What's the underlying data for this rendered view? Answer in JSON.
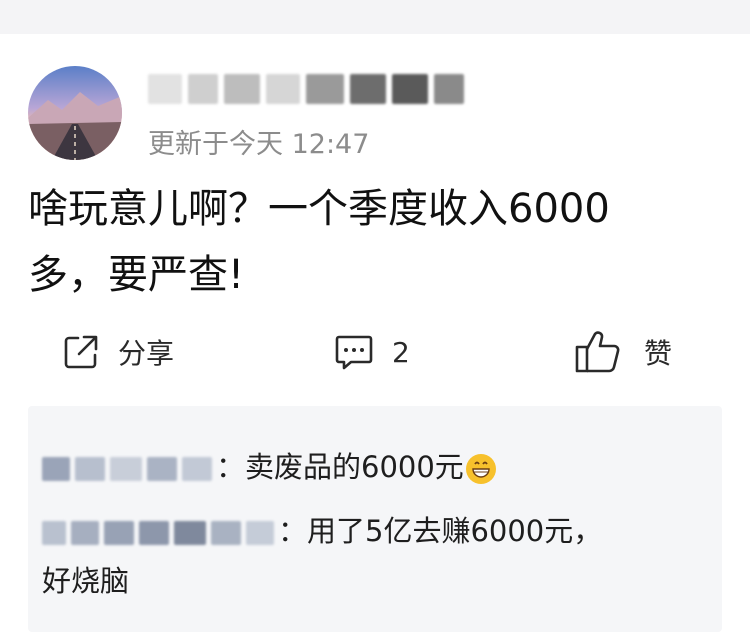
{
  "post": {
    "timestamp": "更新于今天 12:47",
    "text_line1": "啥玩意儿啊？一个季度收入6000",
    "text_line2": "多，要严查!"
  },
  "actions": {
    "share_label": "分享",
    "comment_count": "2",
    "like_label": "赞"
  },
  "comments": [
    {
      "text": "：卖废品的6000元"
    },
    {
      "text": "：用了5亿去赚6000元，",
      "text_cont": "好烧脑"
    }
  ],
  "icons": {
    "share": "share-icon",
    "comment": "comment-icon",
    "like": "thumbs-up-icon",
    "emoji": "grinning-emoji-icon"
  },
  "colors": {
    "timestamp": "#8c8c8c",
    "comment_bg": "#f5f6f8"
  }
}
